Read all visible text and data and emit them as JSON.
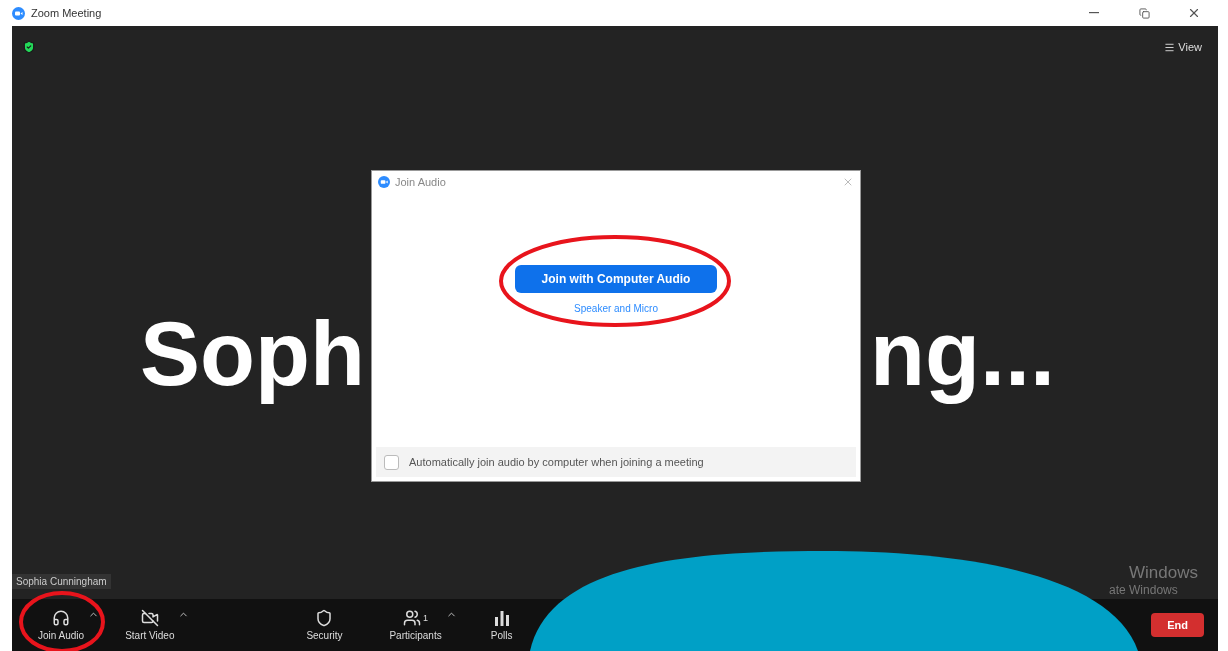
{
  "window": {
    "title": "Zoom Meeting"
  },
  "top_bar": {
    "view_label": "View"
  },
  "speaker_name": {
    "left": "Soph",
    "right": "ng..."
  },
  "participant_label": "Sophia Cunningham",
  "dialog": {
    "title": "Join Audio",
    "primary_button": "Join with Computer Audio",
    "link": "Speaker and Micro",
    "auto_join": {
      "label": "Automatically join audio by computer when joining a meeting",
      "checked": false
    }
  },
  "toolbar": {
    "items": [
      {
        "kind": "audio",
        "label": "Join Audio",
        "has_menu": true
      },
      {
        "kind": "video",
        "label": "Start Video",
        "has_menu": true
      },
      {
        "kind": "security",
        "label": "Security",
        "has_menu": false
      },
      {
        "kind": "participants",
        "label": "Participants",
        "count": "1",
        "has_menu": true
      },
      {
        "kind": "polls",
        "label": "Polls",
        "has_menu": false
      }
    ],
    "end_button": "End"
  },
  "os_notice": {
    "title": "Windows",
    "subtitle": "ate Windows"
  }
}
